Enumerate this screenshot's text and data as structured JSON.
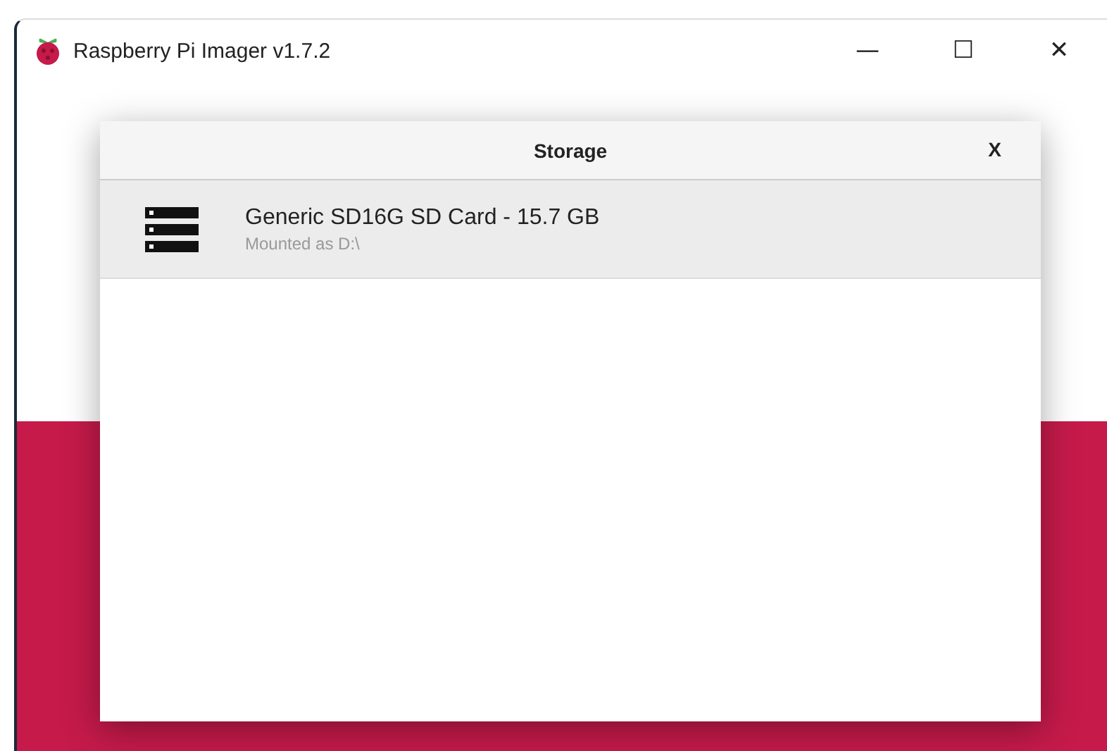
{
  "window": {
    "title": "Raspberry Pi Imager v1.7.2",
    "controls": [
      "—",
      "☐",
      "✕"
    ]
  },
  "dialog": {
    "title": "Storage",
    "close": "X",
    "items": [
      {
        "name": "Generic SD16G SD Card - 15.7 GB",
        "detail": "Mounted as D:\\",
        "selected": true
      }
    ]
  }
}
